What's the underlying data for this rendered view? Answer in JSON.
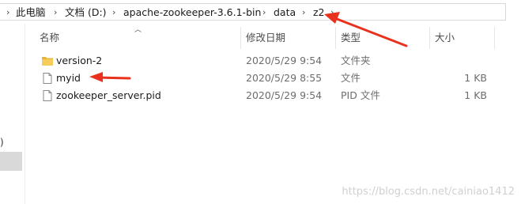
{
  "breadcrumb": {
    "items": [
      "此电脑",
      "文档 (D:)",
      "apache-zookeeper-3.6.1-bin",
      "data",
      "z2"
    ]
  },
  "columns": {
    "name": "名称",
    "modified": "修改日期",
    "type": "类型",
    "size": "大小"
  },
  "files": [
    {
      "name": "version-2",
      "modified": "2020/5/29 9:54",
      "type": "文件夹",
      "size": "",
      "icon": "folder-icon"
    },
    {
      "name": "myid",
      "modified": "2020/5/29 8:55",
      "type": "文件",
      "size": "1 KB",
      "icon": "file-icon"
    },
    {
      "name": "zookeeper_server.pid",
      "modified": "2020/5/29 9:54",
      "type": "PID 文件",
      "size": "1 KB",
      "icon": "file-icon"
    }
  ],
  "nav_fragment": ")",
  "watermark": "https://blog.csdn.net/cainiao1412",
  "colors": {
    "annotation_arrow": "#e8321e",
    "folder": "#f3c64d",
    "selection": "#d9d9d9"
  }
}
